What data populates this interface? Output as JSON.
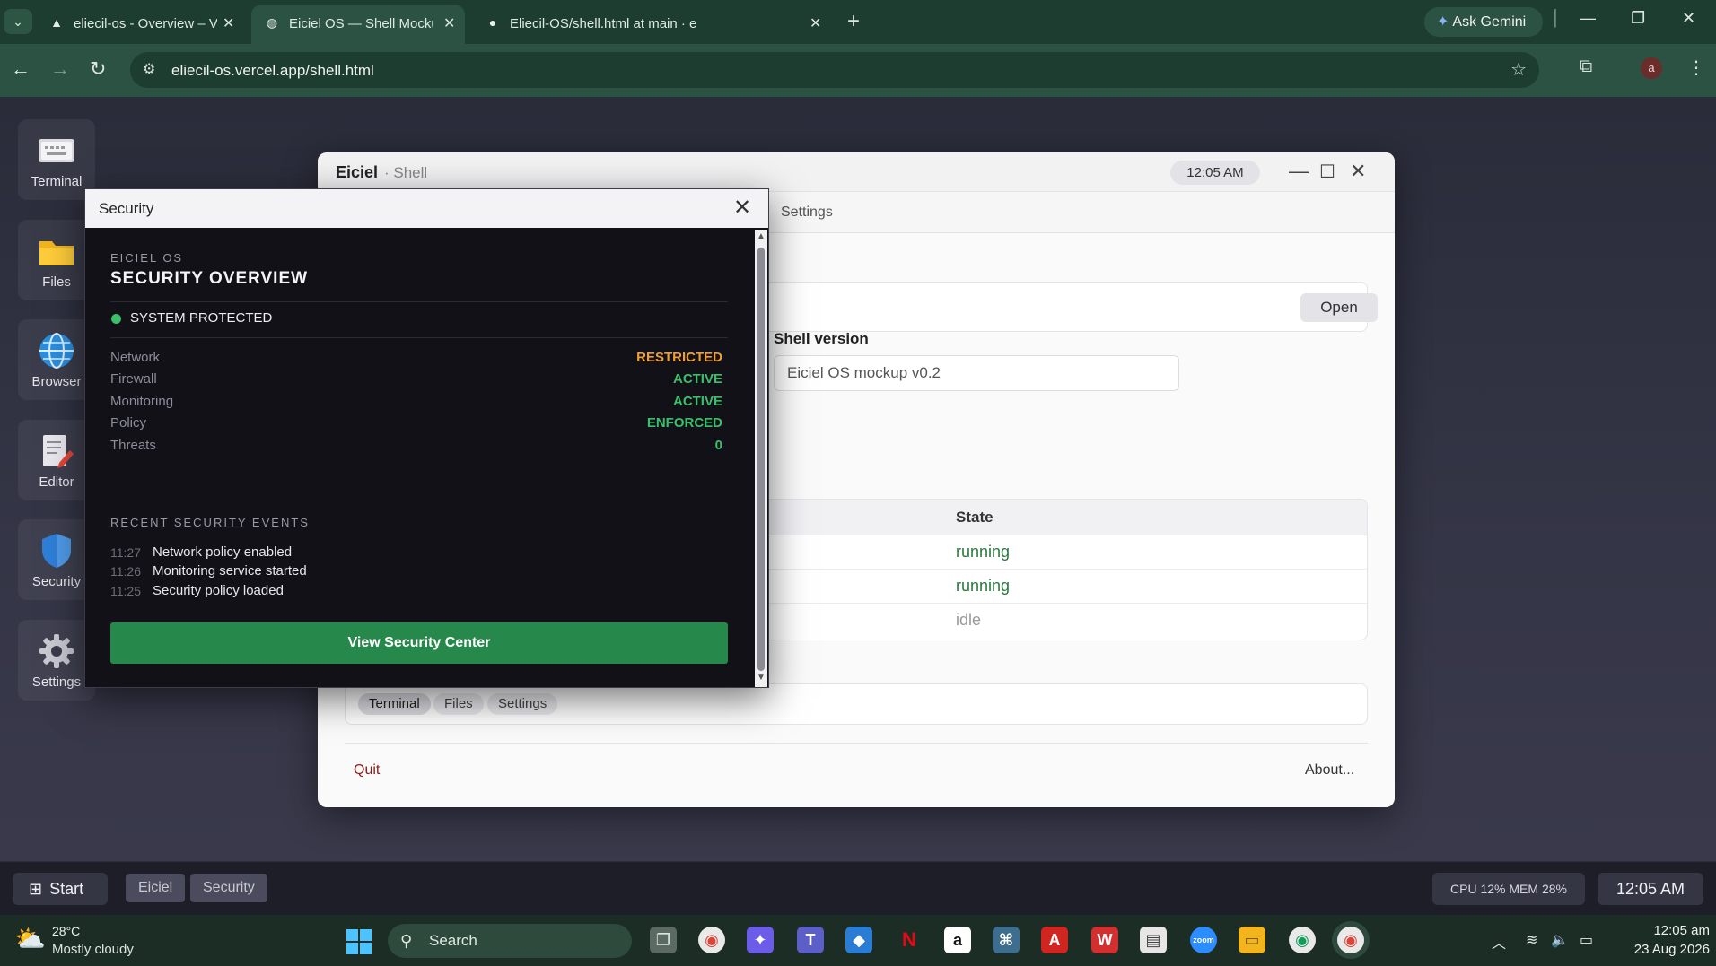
{
  "browser": {
    "tabs": [
      {
        "title": "eliecil-os - Overview – Vercel",
        "icon": "vercel-icon",
        "active": false
      },
      {
        "title": "Eiciel OS — Shell Mockup",
        "icon": "globe-icon",
        "active": true
      },
      {
        "title": "Eliecil-OS/shell.html at main · e",
        "icon": "github-icon",
        "active": false
      }
    ],
    "gemini_label": "Ask Gemini",
    "url": "eliecil-os.vercel.app/shell.html",
    "profile_initial": "a",
    "accent": "#1c3d2f"
  },
  "dock": [
    {
      "label": "Terminal",
      "icon": "terminal-icon"
    },
    {
      "label": "Files",
      "icon": "folder-icon"
    },
    {
      "label": "Browser",
      "icon": "globe-icon"
    },
    {
      "label": "Editor",
      "icon": "editor-icon"
    },
    {
      "label": "Security",
      "icon": "shield-icon"
    },
    {
      "label": "Settings",
      "icon": "gear-icon"
    }
  ],
  "shell": {
    "name": "Eiciel",
    "subtitle": "· Shell",
    "clock": "12:05 AM",
    "menu_settings": "Settings",
    "open_label": "Open",
    "shell_version_label": "Shell version",
    "shell_version_value": "Eiciel OS mockup v0.2",
    "table": {
      "state_header": "State",
      "rows": [
        {
          "state": "running",
          "color": "#2a7a3e"
        },
        {
          "state": "running",
          "color": "#2a7a3e"
        },
        {
          "state": "idle",
          "color": "#999999"
        }
      ]
    },
    "tasks": [
      "Terminal",
      "Files",
      "Settings"
    ],
    "quit_label": "Quit",
    "about_label": "About..."
  },
  "security": {
    "window_title": "Security",
    "eyebrow": "EICIEL OS",
    "headline": "SECURITY OVERVIEW",
    "status": "SYSTEM PROTECTED",
    "status_color": "#3bbf6a",
    "items": [
      {
        "label": "Network",
        "value": "RESTRICTED",
        "color": "#f0a030"
      },
      {
        "label": "Firewall",
        "value": "ACTIVE",
        "color": "#3bbf6a"
      },
      {
        "label": "Monitoring",
        "value": "ACTIVE",
        "color": "#3bbf6a"
      },
      {
        "label": "Policy",
        "value": "ENFORCED",
        "color": "#3bbf6a"
      },
      {
        "label": "Threats",
        "value": "0",
        "color": "#3bbf6a"
      }
    ],
    "events_header": "RECENT SECURITY EVENTS",
    "events": [
      {
        "time": "11:27",
        "message": "Network policy enabled"
      },
      {
        "time": "11:26",
        "message": "Monitoring service started"
      },
      {
        "time": "11:25",
        "message": "Security policy loaded"
      }
    ],
    "cta_label": "View Security Center",
    "cta_color": "#26884a"
  },
  "os_taskbar": {
    "start_label": "Start",
    "windows": [
      "Eiciel",
      "Security"
    ],
    "sys_stats": "CPU 12%   MEM 28%",
    "time": "12:05 AM"
  },
  "windows_taskbar": {
    "temperature": "28°C",
    "weather": "Mostly cloudy",
    "search_label": "Search",
    "time": "12:05 am",
    "date": "23 Aug 2026"
  }
}
